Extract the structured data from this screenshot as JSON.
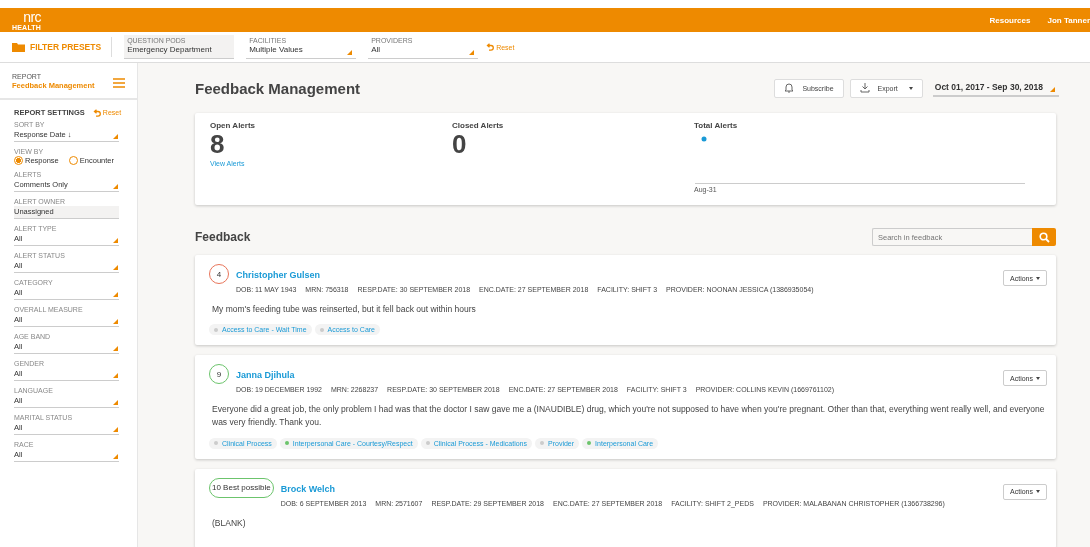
{
  "header": {
    "logo": "nrc",
    "logo_sub": "HEALTH",
    "links": [
      "Resources",
      "Jon Tanner"
    ]
  },
  "filter_bar": {
    "presets": "FILTER PRESETS",
    "filters": [
      {
        "label": "QUESTION PODS",
        "value": "Emergency Department",
        "kind": "text"
      },
      {
        "label": "FACILITIES",
        "value": "Multiple Values",
        "kind": "select"
      },
      {
        "label": "PROVIDERS",
        "value": "All",
        "kind": "select"
      }
    ],
    "reset": "Reset"
  },
  "sidebar": {
    "report_label": "REPORT",
    "report_name": "Feedback Management",
    "settings_title": "REPORT SETTINGS",
    "reset": "Reset",
    "fields": [
      {
        "label": "SORT BY",
        "value": "Response Date ↓",
        "kind": "select"
      },
      {
        "label": "VIEW BY",
        "kind": "radio",
        "options": [
          {
            "label": "Response",
            "selected": true
          },
          {
            "label": "Encounter",
            "selected": false
          }
        ]
      },
      {
        "label": "ALERTS",
        "value": "Comments Only",
        "kind": "select"
      },
      {
        "label": "ALERT OWNER",
        "value": "Unassigned",
        "kind": "text"
      },
      {
        "label": "ALERT TYPE",
        "value": "All",
        "kind": "select"
      },
      {
        "label": "ALERT STATUS",
        "value": "All",
        "kind": "select"
      },
      {
        "label": "CATEGORY",
        "value": "All",
        "kind": "select"
      },
      {
        "label": "OVERALL MEASURE",
        "value": "All",
        "kind": "select"
      },
      {
        "label": "AGE BAND",
        "value": "All",
        "kind": "select"
      },
      {
        "label": "GENDER",
        "value": "All",
        "kind": "select"
      },
      {
        "label": "LANGUAGE",
        "value": "All",
        "kind": "select"
      },
      {
        "label": "MARITAL STATUS",
        "value": "All",
        "kind": "select"
      },
      {
        "label": "RACE",
        "value": "All",
        "kind": "select"
      }
    ]
  },
  "main": {
    "title": "Feedback Management",
    "subscribe": "Subscribe",
    "export": "Export",
    "date_range": "Oct 01, 2017 - Sep 30, 2018",
    "summary": {
      "open_label": "Open Alerts",
      "open_count": "8",
      "view_alerts": "View Alerts",
      "closed_label": "Closed Alerts",
      "closed_count": "0",
      "total_label": "Total Alerts",
      "total_x_label": "Aug-31"
    },
    "feedback_title": "Feedback",
    "search_placeholder": "Search in feedback",
    "items": [
      {
        "score": "4",
        "color": "#e8755a",
        "name": "Christopher Gulsen",
        "meta": [
          "DOB: 11 MAY 1943",
          "MRN: 756318",
          "RESP.DATE: 30 SEPTEMBER 2018",
          "ENC.DATE: 27 SEPTEMBER 2018",
          "FACILITY: SHIFT 3",
          "PROVIDER: NOONAN JESSICA (1386935054)"
        ],
        "comment": "My mom's feeding tube was reinserted, but it fell back out within hours",
        "actions": "Actions",
        "tags": [
          {
            "label": "Access to Care - Wait Time",
            "color": "#cccccc"
          },
          {
            "label": "Access to Care",
            "color": "#cccccc"
          }
        ]
      },
      {
        "score": "9",
        "color": "#6cc46c",
        "name": "Janna Djihula",
        "meta": [
          "DOB: 19 DECEMBER 1992",
          "MRN: 2268237",
          "RESP.DATE: 30 SEPTEMBER 2018",
          "ENC.DATE: 27 SEPTEMBER 2018",
          "FACILITY: SHIFT 3",
          "PROVIDER: COLLINS KEVIN (1669761102)"
        ],
        "comment": "Everyone did a great job, the only problem I had was that the doctor I saw gave me a (INAUDIBLE) drug, which you're not supposed to have when you're pregnant. Other than that, everything went really well, and everyone was very friendly. Thank you.",
        "actions": "Actions",
        "tags": [
          {
            "label": "Clinical Process",
            "color": "#cccccc"
          },
          {
            "label": "Interpersonal Care - Courtesy/Respect",
            "color": "#6cc46c"
          },
          {
            "label": "Clinical Process - Medications",
            "color": "#cccccc"
          },
          {
            "label": "Provider",
            "color": "#cccccc"
          },
          {
            "label": "Interpersonal Care",
            "color": "#6cc46c"
          }
        ]
      },
      {
        "score": "10 Best possible",
        "color": "#6cc46c",
        "name": "Brock Welch",
        "meta": [
          "DOB: 6 SEPTEMBER 2013",
          "MRN: 2571607",
          "RESP.DATE: 29 SEPTEMBER 2018",
          "ENC.DATE: 27 SEPTEMBER 2018",
          "FACILITY: SHIFT 2_PEDS",
          "PROVIDER: MALABANAN CHRISTOPHER (1366738296)"
        ],
        "comment": "(BLANK)",
        "actions": "Actions"
      }
    ]
  }
}
